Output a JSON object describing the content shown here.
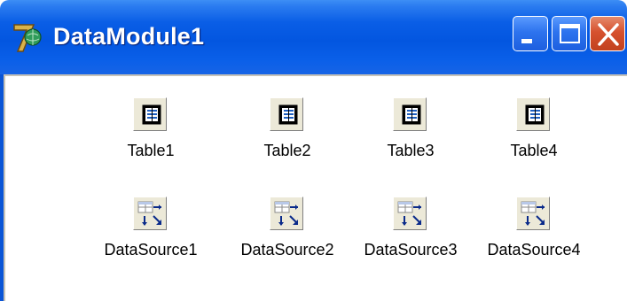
{
  "window": {
    "title": "DataModule1",
    "controls": {
      "minimize_icon": "minimize-icon",
      "maximize_icon": "maximize-icon",
      "close_icon": "close-icon"
    },
    "colors": {
      "titlebar": "#0356e0",
      "close_button": "#d6512e",
      "client_bg": "#ffffff"
    }
  },
  "components": {
    "tables": [
      {
        "label": "Table1",
        "icon": "table-icon"
      },
      {
        "label": "Table2",
        "icon": "table-icon"
      },
      {
        "label": "Table3",
        "icon": "table-icon"
      },
      {
        "label": "Table4",
        "icon": "table-icon"
      }
    ],
    "datasources": [
      {
        "label": "DataSource1",
        "icon": "datasource-icon"
      },
      {
        "label": "DataSource2",
        "icon": "datasource-icon"
      },
      {
        "label": "DataSource3",
        "icon": "datasource-icon"
      },
      {
        "label": "DataSource4",
        "icon": "datasource-icon"
      }
    ]
  }
}
